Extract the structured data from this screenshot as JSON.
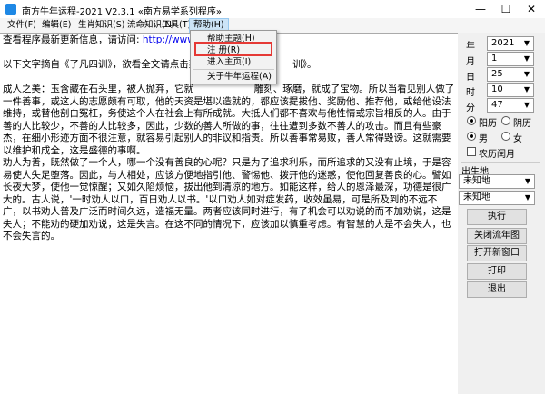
{
  "window": {
    "title": "南方牛年运程-2021   V2.3.1   «南方易学系列程序»",
    "controls": {
      "minimize": "—",
      "maximize": "☐",
      "close": "✕"
    }
  },
  "menu": {
    "items": [
      "文件(F)",
      "编辑(E)",
      "生肖知识(S)",
      "流命知识(N)",
      "工具(T)",
      "帮助(H)"
    ],
    "help_dropdown": [
      "帮助主题(H)",
      "注    册(R)",
      "进入主页(I)",
      "关于牛年运程(A)"
    ]
  },
  "content": {
    "line1_prefix": "查看程序最新更新信息，请访问:",
    "line1_link": "http://www.n",
    "line2": "以下文字摘自《了凡四训》，欲看全文请点击菜",
    "line2_tail": "训》。",
    "para1": "成人之美：玉含藏在石头里，被人抛弃，它就                    雕刻、琢磨，就成了宝物。所以当看见别人做了一件善事，或这人的志愿颇有可取，他的天资是堪以造就的，都应该提拔他、奖励他、推荐他，或给他设法维持，或替他剖白冤枉，务使这个人在社会上有所成就。大抵人们都不喜欢与他性情或宗旨相反的人。由于善的人比较少，不善的人比较多，因此，少数的善人所做的事，往往遭到多数不善人的攻击。而且有些豪杰，在细小形迹方面不很注意，就容易引起别人的非议和指责。所以善事常易败，善人常得毁谤。这就需要以维护和成全，这是盛德的事啊。",
    "para2": "劝人为善，既然做了一个人，哪一个没有善良的心呢？只是为了追求利乐，而所追求的又没有止境，于是容易使人失足堕落。因此，与人相处，应该方便地指引他、警惕他、拨开他的迷惑，使他回复善良的心。譬如长夜大梦，使他一觉惊醒；又如久陷烦恼，拔出他到清凉的地方。如能这样，给人的恩泽最深，功德是很广大的。古人说，'一时劝人以口，百日劝人以书。'以口劝人如对症发药，收效虽易，可是所及到的不远不广，以书劝人普及广泛而时间久远，造福无量。两者应该同时进行，有了机会可以劝说的而不加劝说，这是失人；不能劝的硬加劝说，这是失言。在这不同的情况下，应该加以慎重考虑。有智慧的人是不会失人，也不会失言的。"
  },
  "panel": {
    "year": {
      "label": "年",
      "value": "2021"
    },
    "month": {
      "label": "月",
      "value": "1"
    },
    "day": {
      "label": "日",
      "value": "25"
    },
    "hour": {
      "label": "时",
      "value": "10"
    },
    "minute": {
      "label": "分",
      "value": "47"
    },
    "calendar": {
      "solar": "阳历",
      "lunar": "阴历",
      "selected": "solar"
    },
    "gender": {
      "male": "男",
      "female": "女",
      "selected": "male"
    },
    "leap_month": "农历闰月",
    "birthplace_label": "出生地",
    "birthplace1": "未知地",
    "birthplace2": "未知地",
    "buttons": [
      "执行",
      "关闭流年图",
      "打开新窗口",
      "打印",
      "退出"
    ]
  }
}
